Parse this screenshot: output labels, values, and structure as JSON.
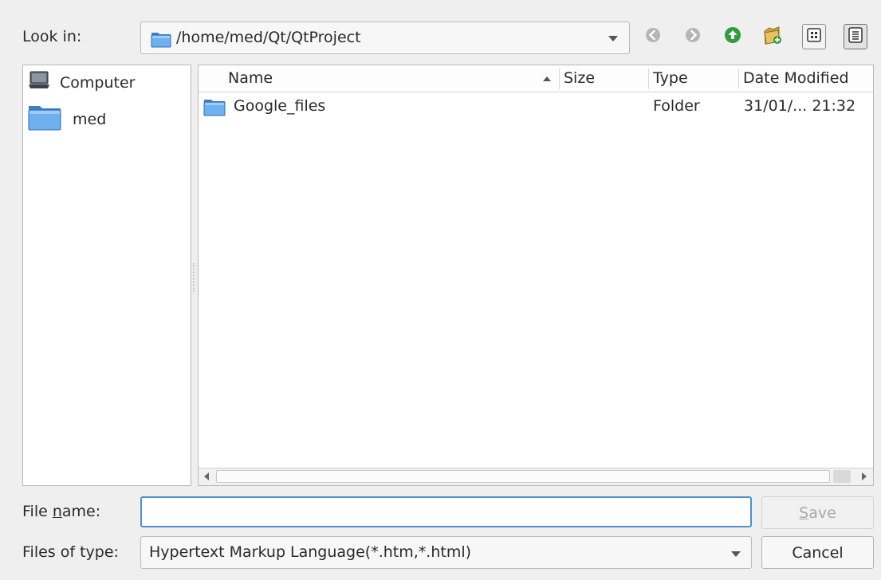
{
  "lookin": {
    "label": "Look in:",
    "path": "/home/med/Qt/QtProject"
  },
  "toolbar": {
    "icons": [
      "back-icon",
      "forward-icon",
      "up-directory-icon",
      "new-folder-icon",
      "icon-view-icon",
      "detail-view-icon"
    ]
  },
  "sidebar": {
    "items": [
      {
        "label": "Computer",
        "icon": "computer-icon"
      },
      {
        "label": "med",
        "icon": "folder-icon"
      }
    ]
  },
  "filelist": {
    "columns": [
      "Name",
      "Size",
      "Type",
      "Date Modified"
    ],
    "sort_column": "Name",
    "rows": [
      {
        "name": "Google_files",
        "size": "",
        "type": "Folder",
        "date": "31/01/... 21:32"
      }
    ]
  },
  "filename": {
    "label_pre": "File ",
    "label_mnemonic": "n",
    "label_post": "ame:",
    "value": ""
  },
  "filetype": {
    "label": "Files of type:",
    "selected": "Hypertext Markup Language(*.htm,*.html)"
  },
  "buttons": {
    "save_mnemonic": "S",
    "save_rest": "ave",
    "cancel": "Cancel"
  },
  "colors": {
    "focus_border": "#4f8fd0",
    "folder_blue": "#5a9be0",
    "up_green": "#2f9d3b"
  }
}
